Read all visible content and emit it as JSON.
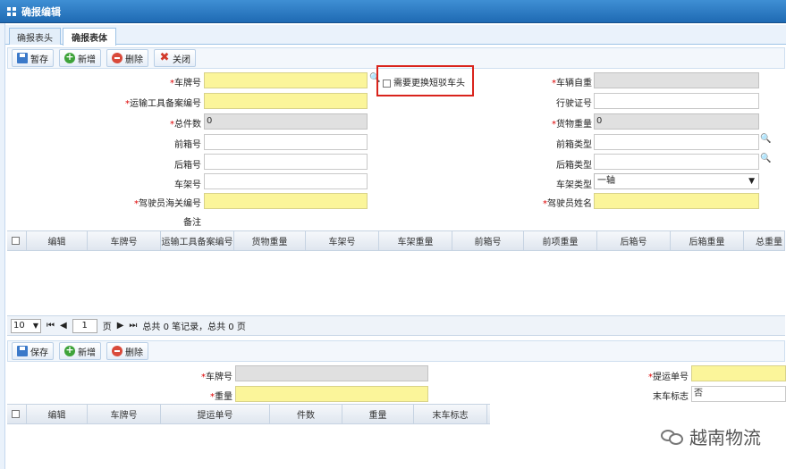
{
  "window": {
    "title": "确报编辑"
  },
  "tabs": [
    {
      "label": "确报表头"
    },
    {
      "label": "确报表体"
    }
  ],
  "toolbar1": {
    "save_draft": "暂存",
    "add": "新增",
    "delete": "删除",
    "close": "关闭"
  },
  "form1": {
    "plate_no": {
      "label": "车牌号",
      "value": ""
    },
    "tool_record_no": {
      "label": "运输工具备案编号",
      "value": ""
    },
    "total_pieces": {
      "label": "总件数",
      "value": "0"
    },
    "front_box_no": {
      "label": "前箱号",
      "value": ""
    },
    "rear_box_no": {
      "label": "后箱号",
      "value": ""
    },
    "frame_no": {
      "label": "车架号",
      "value": ""
    },
    "driver_customs_no": {
      "label": "驾驶员海关编号",
      "value": ""
    },
    "remark": {
      "label": "备注",
      "value": ""
    },
    "need_change_head": {
      "label": "需要更换短驳车头"
    },
    "vehicle_weight": {
      "label": "车辆自重",
      "value": ""
    },
    "license_no": {
      "label": "行驶证号",
      "value": ""
    },
    "cargo_weight": {
      "label": "货物重量",
      "value": "0"
    },
    "front_box_type": {
      "label": "前箱类型",
      "value": ""
    },
    "rear_box_type": {
      "label": "后箱类型",
      "value": ""
    },
    "frame_type": {
      "label": "车架类型",
      "value": "一轴"
    },
    "driver_name": {
      "label": "驾驶员姓名",
      "value": ""
    }
  },
  "grid1": {
    "columns": [
      "编辑",
      "车牌号",
      "运输工具备案编号",
      "货物重量",
      "车架号",
      "车架重量",
      "前箱号",
      "前项重量",
      "后箱号",
      "后箱重量",
      "总重量"
    ]
  },
  "pager": {
    "page_size": "10",
    "page": "1",
    "page_prefix": "页",
    "summary": "总共 0 笔记录，总共 0 页"
  },
  "toolbar2": {
    "save": "保存",
    "add": "新增",
    "delete": "删除"
  },
  "form2": {
    "plate_no": {
      "label": "车牌号",
      "value": ""
    },
    "weight": {
      "label": "重量",
      "value": ""
    },
    "bill_no": {
      "label": "提运单号",
      "value": ""
    },
    "last_car_flag": {
      "label": "末车标志",
      "value": "否"
    }
  },
  "grid2": {
    "columns": [
      "编辑",
      "车牌号",
      "提运单号",
      "件数",
      "重量",
      "末车标志"
    ]
  },
  "watermark": {
    "text": "越南物流"
  }
}
